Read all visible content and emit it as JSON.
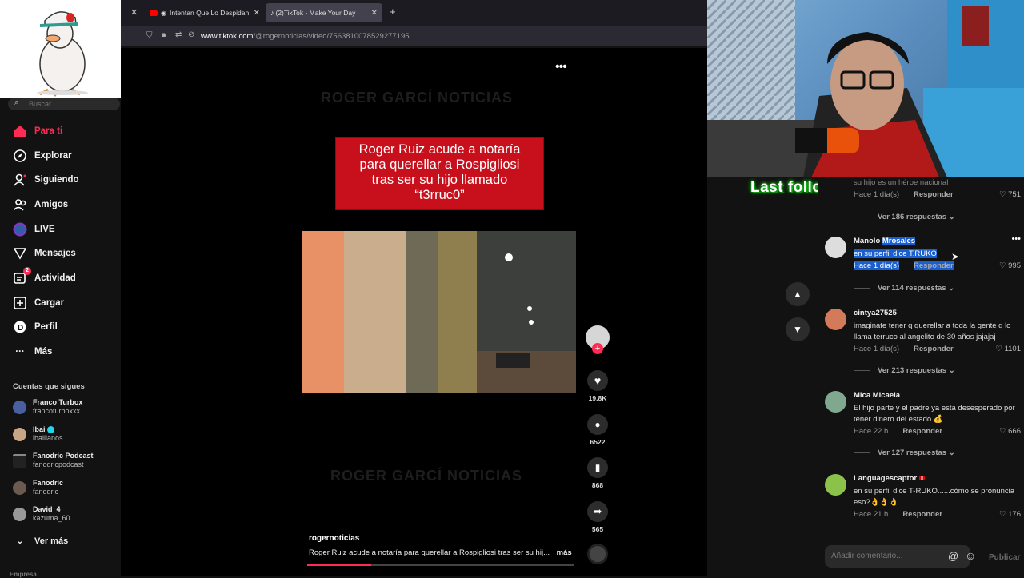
{
  "browser": {
    "tabs": [
      {
        "label": "Intentan Que Lo Despidan"
      },
      {
        "label": "(2)TikTok - Make Your Day"
      }
    ],
    "url_host": "www.tiktok.com",
    "url_path": "/@rogernoticias/video/7563810078529277195"
  },
  "sidebar": {
    "search_placeholder": "Buscar",
    "nav": [
      {
        "label": "Para ti",
        "icon": "home-icon"
      },
      {
        "label": "Explorar",
        "icon": "compass-icon"
      },
      {
        "label": "Siguiendo",
        "icon": "following-icon"
      },
      {
        "label": "Amigos",
        "icon": "friends-icon"
      },
      {
        "label": "LIVE",
        "icon": "live-icon"
      },
      {
        "label": "Mensajes",
        "icon": "messages-icon"
      },
      {
        "label": "Actividad",
        "icon": "activity-icon",
        "badge": "2"
      },
      {
        "label": "Cargar",
        "icon": "upload-icon"
      },
      {
        "label": "Perfil",
        "icon": "profile-icon"
      },
      {
        "label": "Más",
        "icon": "more-icon"
      }
    ],
    "following_title": "Cuentas que sigues",
    "following": [
      {
        "name": "Franco Turbox",
        "user": "francoturboxxx"
      },
      {
        "name": "Ibai",
        "user": "ibaillanos"
      },
      {
        "name": "Fanodric Podcast",
        "user": "fanodricpodcast"
      },
      {
        "name": "Fanodric",
        "user": "fanodric"
      },
      {
        "name": "David_4",
        "user": "kazuma_60"
      }
    ],
    "see_more": "Ver más",
    "footer": "Empresa"
  },
  "video": {
    "watermark_top": "ROGER GARCÍ  NOTICIAS",
    "watermark_bottom": "ROGER GARCÍ  NOTICIAS",
    "caption_lines": [
      "Roger Ruiz acude a notaría",
      "para querellar a Rospigliosi",
      "tras ser su hijo llamado",
      "“t3rruc0”"
    ],
    "author": "rogernoticias",
    "description": "Roger Ruiz acude a notaría para querellar a Rospigliosi tras ser su hij...",
    "more": "más",
    "likes": "19.8K",
    "comments": "6522",
    "saves": "868",
    "shares": "565",
    "progress": 0.24
  },
  "overlay": {
    "last_follower": "Last follower: Leobrucce"
  },
  "comments": {
    "partial": {
      "text": "su hijo es un héroe nacional",
      "meta": "Hace 1 día(s)",
      "reply": "Responder",
      "likes": "751"
    },
    "more_0": "Ver 186 respuestas",
    "items": [
      {
        "user": "Manolo",
        "user_highlight": "Mrosales",
        "text": "en su perfil dice T.RUKO",
        "meta": "Hace 1 día(s)",
        "reply": "Responder",
        "likes": "995",
        "more": "Ver 114 respuestas"
      },
      {
        "user": "cintya27525",
        "text": "imaginate tener q querellar a toda la gente q lo llama terruco al angelito de 30 años jajajaj",
        "meta": "Hace 1 día(s)",
        "reply": "Responder",
        "likes": "1101",
        "more": "Ver 213 respuestas"
      },
      {
        "user": "Mica Micaela",
        "text": "El hijo parte y el padre ya esta desesperado por tener dinero del estado 💰",
        "meta": "Hace 22 h",
        "reply": "Responder",
        "likes": "666",
        "more": "Ver 127 respuestas"
      },
      {
        "user": "Languagescaptor",
        "text": "en su perfil dice T-RUKO......cómo se pronuncia eso?👌👌👌",
        "meta": "Hace 21 h",
        "reply": "Responder",
        "likes": "176",
        "more": ""
      }
    ],
    "input_placeholder": "Añadir comentario...",
    "publish": "Publicar"
  },
  "colors": {
    "accent": "#fe2c55",
    "caption_bg": "#c8101c",
    "highlight": "#1a5fcf"
  }
}
